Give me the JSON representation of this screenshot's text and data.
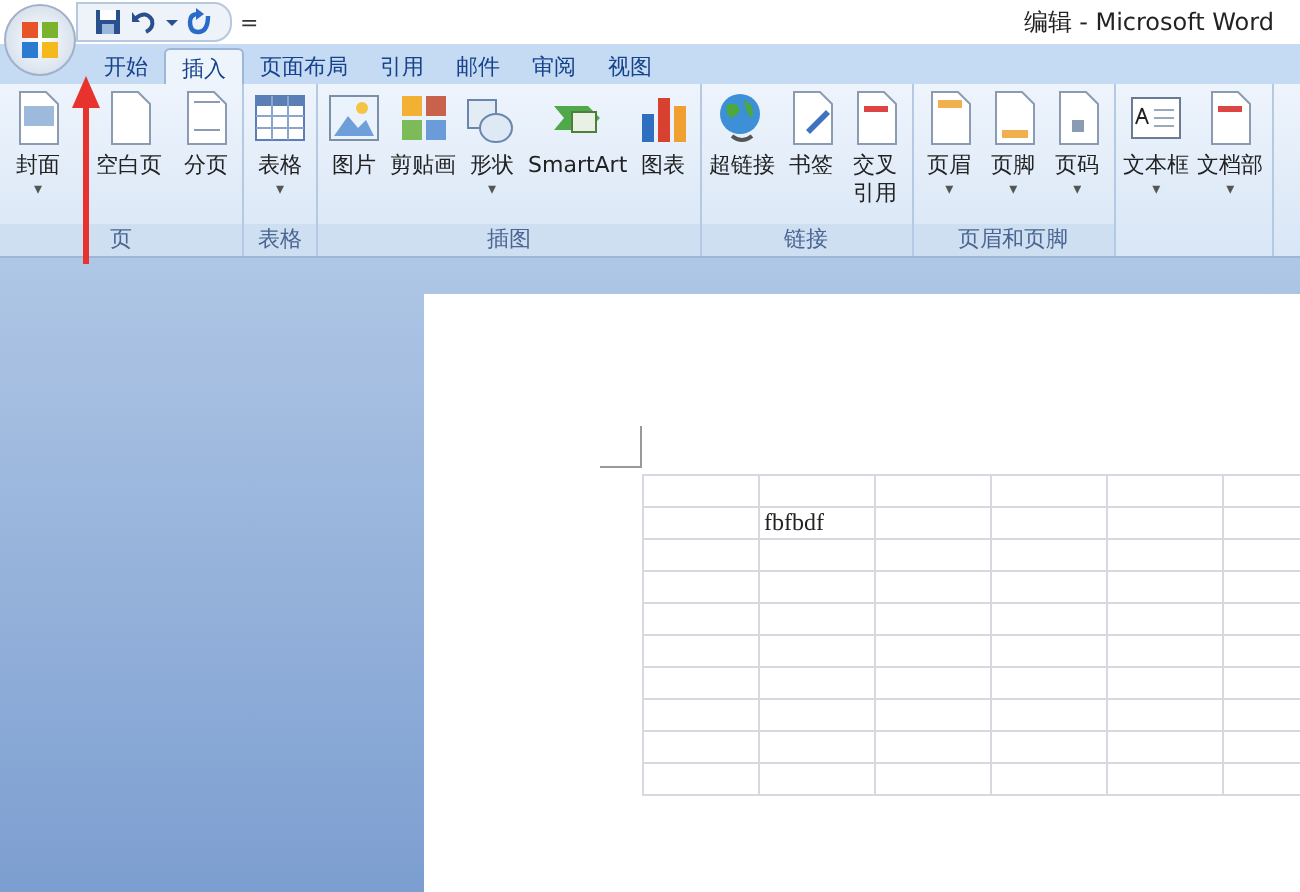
{
  "window": {
    "title": "编辑 - Microsoft Word"
  },
  "quick_access": {
    "customize": "="
  },
  "tabs": [
    {
      "label": "开始",
      "selected": false
    },
    {
      "label": "插入",
      "selected": true
    },
    {
      "label": "页面布局",
      "selected": false
    },
    {
      "label": "引用",
      "selected": false
    },
    {
      "label": "邮件",
      "selected": false
    },
    {
      "label": "审阅",
      "selected": false
    },
    {
      "label": "视图",
      "selected": false
    }
  ],
  "ribbon_groups": [
    {
      "label": "页",
      "buttons": [
        {
          "label": "封面",
          "caret": "▾"
        },
        {
          "label": "空白页"
        },
        {
          "label": "分页"
        }
      ]
    },
    {
      "label": "表格",
      "buttons": [
        {
          "label": "表格",
          "caret": "▾"
        }
      ]
    },
    {
      "label": "插图",
      "buttons": [
        {
          "label": "图片"
        },
        {
          "label": "剪贴画"
        },
        {
          "label": "形状",
          "caret": "▾"
        },
        {
          "label": "SmartArt"
        },
        {
          "label": "图表"
        }
      ]
    },
    {
      "label": "链接",
      "buttons": [
        {
          "label": "超链接"
        },
        {
          "label": "书签"
        },
        {
          "label": "交叉引用"
        }
      ]
    },
    {
      "label": "页眉和页脚",
      "buttons": [
        {
          "label": "页眉",
          "caret": "▾"
        },
        {
          "label": "页脚",
          "caret": "▾"
        },
        {
          "label": "页码",
          "caret": "▾"
        }
      ]
    },
    {
      "buttons": [
        {
          "label": "文本框",
          "caret": "▾"
        },
        {
          "label": "文档部",
          "caret": "▾"
        }
      ]
    }
  ],
  "document": {
    "table_text": "fbfbdf"
  }
}
